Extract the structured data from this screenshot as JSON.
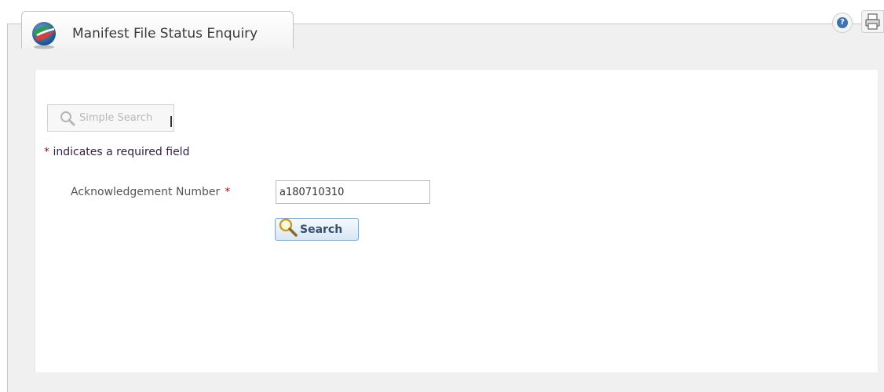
{
  "tab": {
    "title": "Manifest File Status Enquiry"
  },
  "toolbar": {
    "help_icon": "help-icon",
    "print_icon": "print-icon"
  },
  "search": {
    "simple_search_label": "Simple Search",
    "required_star": "*",
    "required_note": "indicates a required field",
    "ack_label": "Acknowledgement Number",
    "ack_value": "a180710310",
    "search_button_label": "Search"
  },
  "colors": {
    "required": "#cc0000",
    "button_border": "#7fa6cc",
    "button_text": "#35506e"
  }
}
